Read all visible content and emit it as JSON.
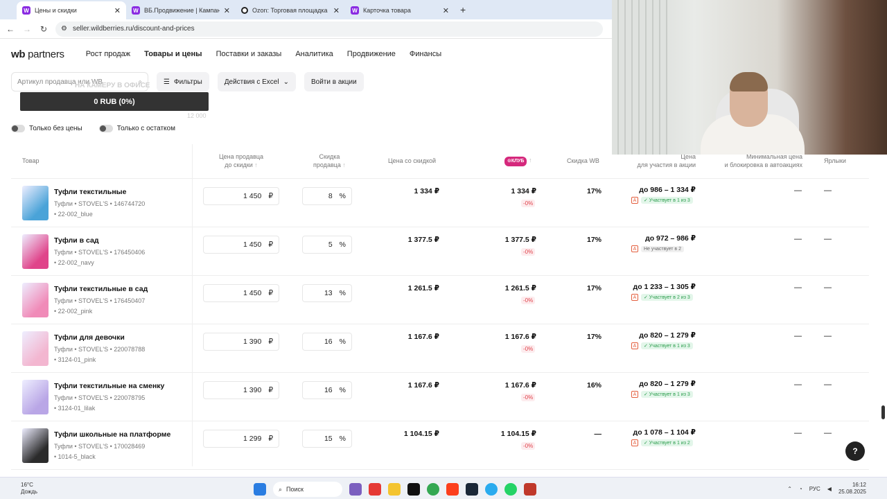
{
  "browser": {
    "tabs": [
      {
        "label": "Цены и скидки",
        "icon": "wildberries-icon"
      },
      {
        "label": "ВБ.Продвижение | Кампании",
        "icon": "wildberries-icon"
      },
      {
        "label": "Ozon: Торговая площадка",
        "icon": "ozon-icon"
      },
      {
        "label": "Карточка товара",
        "icon": "wildberries-icon"
      }
    ],
    "url": "seller.wildberries.ru/discount-and-prices"
  },
  "header": {
    "logo_wb": "wb",
    "logo_partners": "partners",
    "nav": [
      "Рост продаж",
      "Товары и цены",
      "Поставки и заказы",
      "Аналитика",
      "Продвижение",
      "Финансы"
    ],
    "nav_selected": 1
  },
  "filters": {
    "search_placeholder": "Артикул продавца или WB",
    "filters_label": "Фильтры",
    "excel_label": "Действия с Excel",
    "promo_label": "Войти в акции",
    "overlay_text": "НА КАМЕРУ В ОФИСЕ",
    "progress_label": "0 RUB (0%)",
    "progress_max": "12 000",
    "toggle_no_price": "Только без цены",
    "toggle_stock": "Только с остатком"
  },
  "table": {
    "headers": {
      "product": "Товар",
      "seller_price_1": "Цена продавца",
      "seller_price_2": "до скидки",
      "seller_discount_1": "Скидка",
      "seller_discount_2": "продавца",
      "discount_price": "Цена со скидкой",
      "club": "КЛУБ",
      "wb_discount": "Скидка WB",
      "promo_price_1": "Цена",
      "promo_price_2": "для участия в акции",
      "min_price_1": "Минимальная цена",
      "min_price_2": "и блокировка в автоакциях",
      "labels": "Ярлыки"
    },
    "rows": [
      {
        "name": "Туфли текстильные",
        "meta1": "Туфли • STOVEL'S • 146744720",
        "meta2": "• 22-002_blue",
        "price": "1 450",
        "currency": "₽",
        "discount": "8",
        "pct": "%",
        "discounted": "1 334 ₽",
        "club": "1 334 ₽",
        "club_pct": "-0%",
        "wb": "17%",
        "promo": "до 986 – 1 334 ₽",
        "promo_status": "✓ Участвует в 1 из 3",
        "promo_ok": true,
        "min": "—",
        "labels": "—",
        "img": "#4aa3d8"
      },
      {
        "name": "Туфли в сад",
        "meta1": "Туфли • STOVEL'S • 176450406",
        "meta2": "• 22-002_navy",
        "price": "1 450",
        "currency": "₽",
        "discount": "5",
        "pct": "%",
        "discounted": "1 377.5 ₽",
        "club": "1 377.5 ₽",
        "club_pct": "-0%",
        "wb": "17%",
        "promo": "до 972 – 986 ₽",
        "promo_status": "Не участвует в 2",
        "promo_ok": false,
        "min": "—",
        "labels": "—",
        "img": "#e0448a"
      },
      {
        "name": "Туфли текстильные в сад",
        "meta1": "Туфли • STOVEL'S • 176450407",
        "meta2": "• 22-002_pink",
        "price": "1 450",
        "currency": "₽",
        "discount": "13",
        "pct": "%",
        "discounted": "1 261.5 ₽",
        "club": "1 261.5 ₽",
        "club_pct": "-0%",
        "wb": "17%",
        "promo": "до 1 233 – 1 305 ₽",
        "promo_status": "✓ Участвует в 2 из 3",
        "promo_ok": true,
        "min": "—",
        "labels": "—",
        "img": "#f08bb8"
      },
      {
        "name": "Туфли для девочки",
        "meta1": "Туфли • STOVEL'S • 220078788",
        "meta2": "• 3124-01_pink",
        "price": "1 390",
        "currency": "₽",
        "discount": "16",
        "pct": "%",
        "discounted": "1 167.6 ₽",
        "club": "1 167.6 ₽",
        "club_pct": "-0%",
        "wb": "17%",
        "promo": "до 820 – 1 279 ₽",
        "promo_status": "✓ Участвует в 1 из 3",
        "promo_ok": true,
        "min": "—",
        "labels": "—",
        "img": "#f3b6d0"
      },
      {
        "name": "Туфли текстильные на сменку",
        "meta1": "Туфли • STOVEL'S • 220078795",
        "meta2": "• 3124-01_lilak",
        "price": "1 390",
        "currency": "₽",
        "discount": "16",
        "pct": "%",
        "discounted": "1 167.6 ₽",
        "club": "1 167.6 ₽",
        "club_pct": "-0%",
        "wb": "16%",
        "promo": "до 820 – 1 279 ₽",
        "promo_status": "✓ Участвует в 1 из 3",
        "promo_ok": true,
        "min": "—",
        "labels": "—",
        "img": "#b9a6e6"
      },
      {
        "name": "Туфли школьные на платформе",
        "meta1": "Туфли • STOVEL'S • 170028469",
        "meta2": "• 1014-5_black",
        "price": "1 299",
        "currency": "₽",
        "discount": "15",
        "pct": "%",
        "discounted": "1 104.15 ₽",
        "club": "1 104.15 ₽",
        "club_pct": "-0%",
        "wb": "—",
        "promo": "до 1 078 – 1 104 ₽",
        "promo_status": "✓ Участвует в 1 из 2",
        "promo_ok": true,
        "min": "—",
        "labels": "—",
        "img": "#2b2b2b"
      }
    ]
  },
  "help_label": "?",
  "taskbar": {
    "temp": "16°C",
    "weather": "Дождь",
    "search": "Поиск",
    "lang": "РУС",
    "time": "16:12",
    "date": "25.08.2025"
  },
  "colors": {
    "accent": "#8a2be2",
    "club": "#d5287c",
    "negative": "#e0434b",
    "ok": "#2a9c4b"
  }
}
